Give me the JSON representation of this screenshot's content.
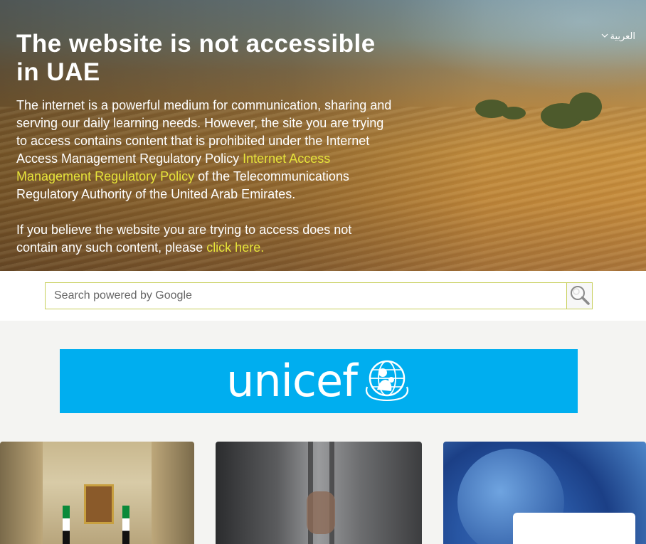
{
  "language_switch": {
    "label": "العربية",
    "icon": "chevron-down-icon"
  },
  "hero": {
    "title": "The website is not accessible in UAE",
    "paragraph1_intro": "The internet is a powerful medium for communication, sharing and serving our daily learning needs. However, the site you are trying to access contains content that is prohibited under the Internet Access Management Regulatory Policy ",
    "paragraph1_link": "Internet Access Management Regulatory Policy",
    "paragraph1_outro": " of the Telecommunications Regulatory Authority of the United Arab Emirates.",
    "paragraph2_intro": "If you believe the website you are trying to access does not contain any such content, please ",
    "paragraph2_link": "click here."
  },
  "search": {
    "placeholder": "Search powered by Google",
    "value": "",
    "button_icon": "search-icon"
  },
  "banner": {
    "brand": "unicef",
    "icon": "unicef-emblem-icon",
    "color": "#00aeef"
  },
  "colors": {
    "link": "#e6e43a",
    "search_border": "#c7cf5a",
    "page_bg": "#f4f4f2"
  }
}
